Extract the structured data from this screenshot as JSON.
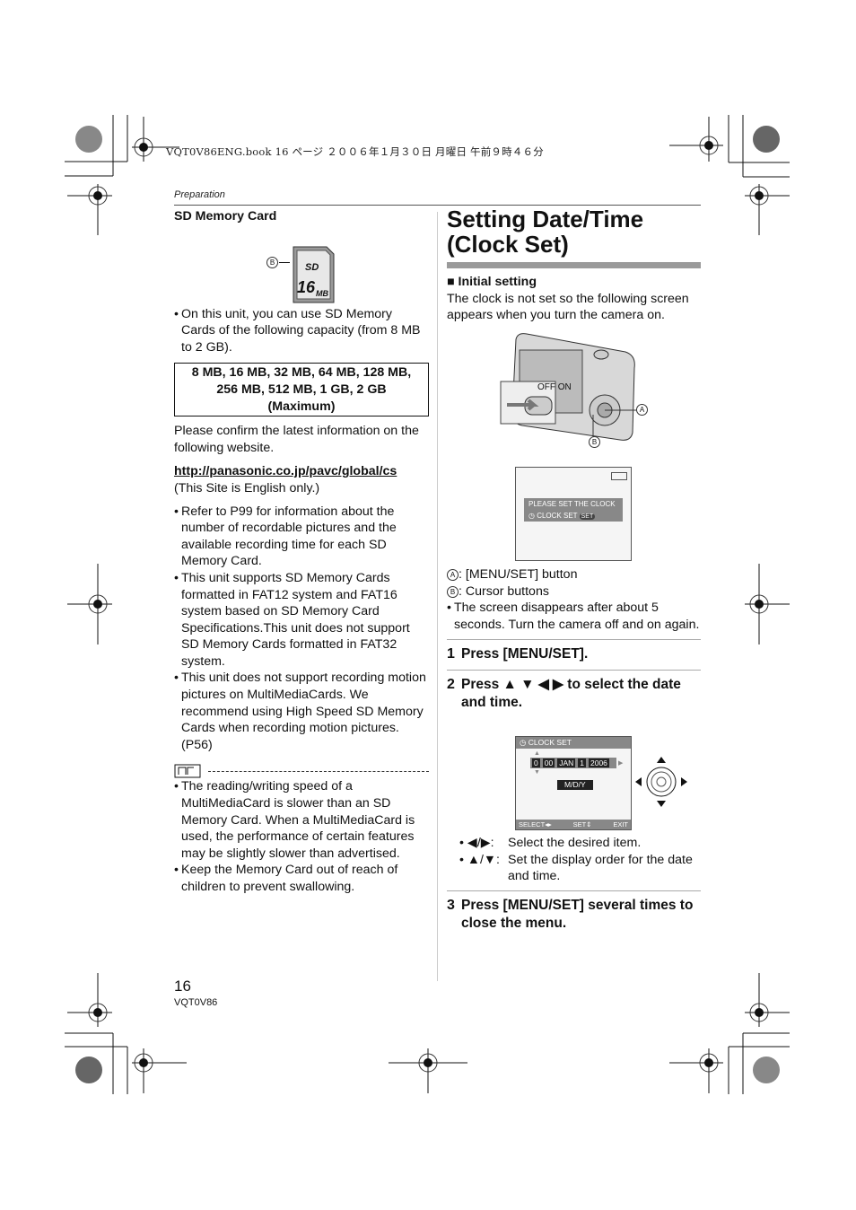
{
  "print_header": "VQT0V86ENG.book  16 ページ  ２００６年１月３０日  月曜日  午前９時４６分",
  "section_label": "Preparation",
  "left": {
    "heading": "SD Memory Card",
    "card_callout": "B",
    "card_capacity_label": "16",
    "card_capacity_unit": "MB",
    "card_logo": "SD",
    "intro_bullet": "On this unit, you can use SD Memory Cards of the following capacity (from 8 MB to 2 GB).",
    "capacity_box": [
      "8 MB, 16 MB, 32 MB, 64 MB, 128 MB,",
      "256 MB, 512 MB, 1 GB, 2 GB",
      "(Maximum)"
    ],
    "confirm_text": "Please confirm the latest information on the following website.",
    "website_link": "http://panasonic.co.jp/pavc/global/cs",
    "site_note": "(This Site is English only.)",
    "bullets": [
      "Refer to P99 for information about the number of recordable pictures and the available recording time for each SD Memory Card.",
      "This unit supports SD Memory Cards formatted in FAT12 system and FAT16 system based on SD Memory Card Specifications.This unit does not support SD Memory Cards formatted in FAT32 system.",
      "This unit does not support recording motion pictures on MultiMediaCards. We recommend using High Speed SD Memory Cards when recording motion pictures. (P56)"
    ],
    "notes": [
      "The reading/writing speed of a MultiMediaCard is slower than an SD Memory Card. When a MultiMediaCard is used, the performance of certain features may be slightly slower than advertised.",
      "Keep the Memory Card out of reach of children to prevent swallowing."
    ]
  },
  "right": {
    "title_line1": "Setting Date/Time",
    "title_line2": "(Clock Set)",
    "subheading": "Initial setting",
    "intro": "The clock is not set so the following screen appears when you turn the camera on.",
    "camera_switch_label": "OFF ON",
    "callout_a": "A",
    "callout_b": "B",
    "lcd1": {
      "line1": "PLEASE SET THE CLOCK",
      "line2": "CLOCK SET",
      "badge": "SET"
    },
    "legend": [
      {
        "key": "A",
        "text": ":  [MENU/SET] button"
      },
      {
        "key": "B",
        "text": ":  Cursor buttons"
      }
    ],
    "screen_note": "The screen disappears after about 5 seconds. Turn the camera off and on again.",
    "step1": {
      "num": "1",
      "text": "Press [MENU/SET]."
    },
    "step2": {
      "num": "2",
      "text": "Press ▲ ▼ ◀ ▶ to select the date and time."
    },
    "lcd2": {
      "header": "CLOCK SET",
      "hour": "0",
      "minute": "00",
      "month": "JAN",
      "day": "1",
      "year": "2006",
      "order": "M/D/Y",
      "footer_select": "SELECT",
      "footer_set": "SET",
      "footer_exit": "EXIT"
    },
    "sub_bullets": [
      {
        "key": "◀/▶:",
        "text": "Select the desired item."
      },
      {
        "key": "▲/▼:",
        "text": "Set the display order for the date and time."
      }
    ],
    "step3": {
      "num": "3",
      "text": "Press [MENU/SET] several times to close the menu."
    }
  },
  "footer": {
    "page_number": "16",
    "model_code": "VQT0V86"
  }
}
